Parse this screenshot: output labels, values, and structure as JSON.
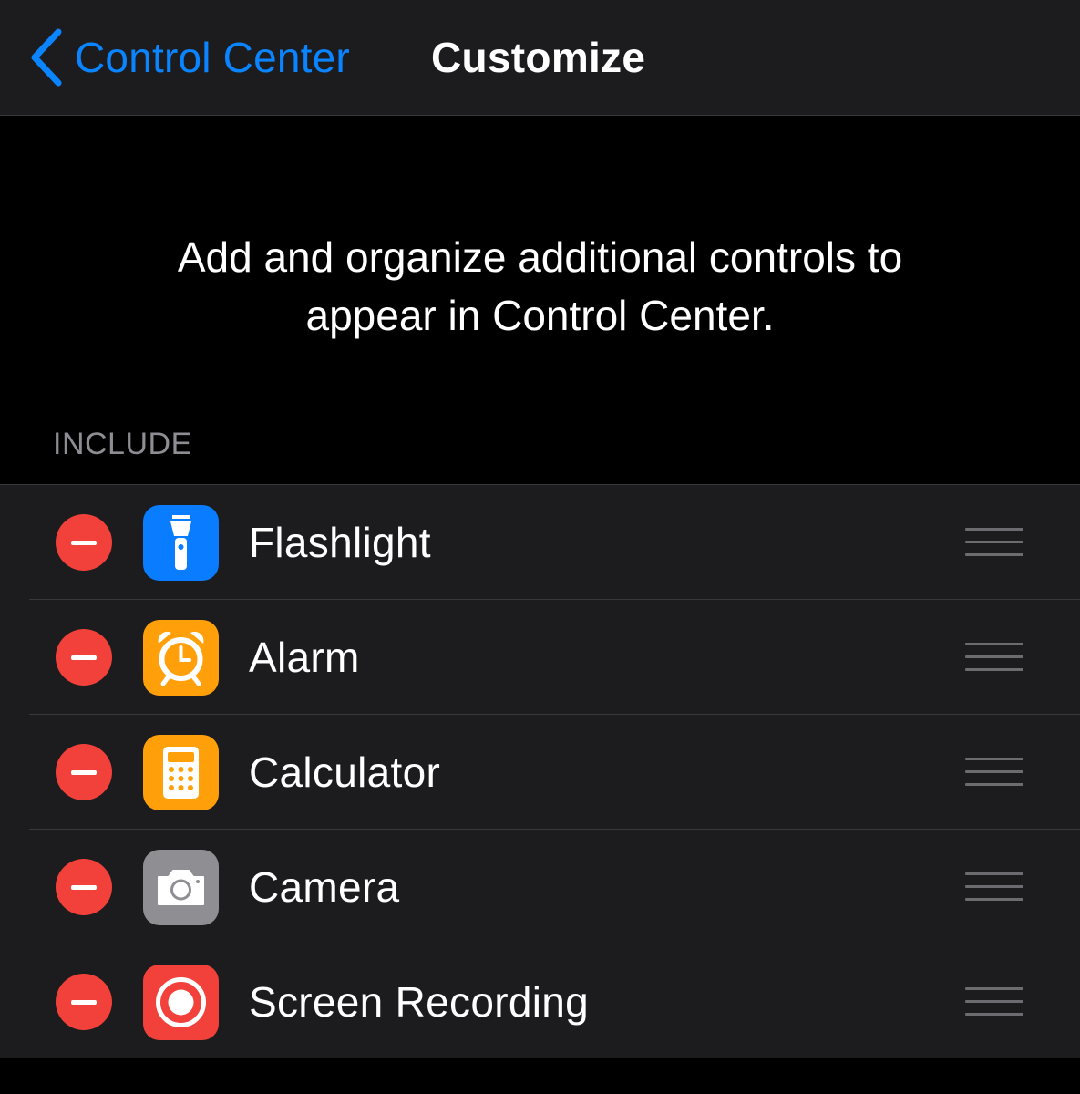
{
  "nav": {
    "back_label": "Control Center",
    "title": "Customize"
  },
  "description": "Add and organize additional controls to appear in Control Center.",
  "section_header": "INCLUDE",
  "items": [
    {
      "label": "Flashlight",
      "icon": "flashlight-icon",
      "color": "#0a7cff"
    },
    {
      "label": "Alarm",
      "icon": "alarm-icon",
      "color": "#ff9f0a"
    },
    {
      "label": "Calculator",
      "icon": "calculator-icon",
      "color": "#ff9f0a"
    },
    {
      "label": "Camera",
      "icon": "camera-icon",
      "color": "#8e8e93"
    },
    {
      "label": "Screen Recording",
      "icon": "screen-recording-icon",
      "color": "#f2413a"
    }
  ],
  "colors": {
    "accent": "#0a84ff",
    "delete": "#f2413a",
    "background": "#000000",
    "cell": "#1c1c1e"
  }
}
